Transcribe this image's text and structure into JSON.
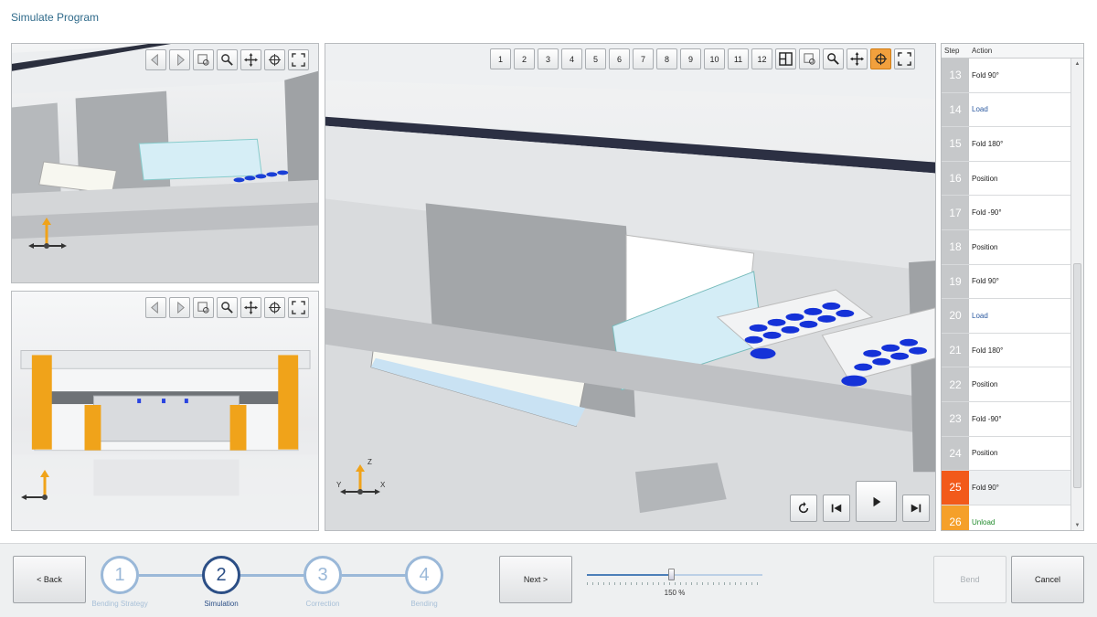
{
  "title": "Simulate Program",
  "viewport_toolbar": {
    "icons": [
      "arrow-left-icon",
      "arrow-right-icon",
      "zoom-window-icon",
      "zoom-icon",
      "pan-icon",
      "rotate-icon",
      "fit-icon"
    ]
  },
  "main_toolbar": {
    "view_buttons": [
      "1",
      "2",
      "3",
      "4",
      "5",
      "6",
      "7",
      "8",
      "9",
      "10",
      "11",
      "12"
    ],
    "icons": [
      "layout-icon",
      "zoom-window-icon",
      "zoom-icon",
      "pan-icon",
      "rotate-icon",
      "fit-icon"
    ],
    "active_icon": "rotate-icon"
  },
  "axis_labels": {
    "z": "Z",
    "y": "Y",
    "x": "X"
  },
  "playback": [
    "reset-icon",
    "step-back-icon",
    "play-icon",
    "step-forward-icon"
  ],
  "steps": {
    "header_step": "Step",
    "header_action": "Action",
    "rows": [
      {
        "n": "13",
        "action": "Fold 90°",
        "kind": "fold"
      },
      {
        "n": "14",
        "action": "Load",
        "kind": "load"
      },
      {
        "n": "15",
        "action": "Fold 180°",
        "kind": "fold"
      },
      {
        "n": "16",
        "action": "Position",
        "kind": "position"
      },
      {
        "n": "17",
        "action": "Fold -90°",
        "kind": "fold"
      },
      {
        "n": "18",
        "action": "Position",
        "kind": "position"
      },
      {
        "n": "19",
        "action": "Fold 90°",
        "kind": "fold"
      },
      {
        "n": "20",
        "action": "Load",
        "kind": "load"
      },
      {
        "n": "21",
        "action": "Fold 180°",
        "kind": "fold"
      },
      {
        "n": "22",
        "action": "Position",
        "kind": "position"
      },
      {
        "n": "23",
        "action": "Fold -90°",
        "kind": "fold"
      },
      {
        "n": "24",
        "action": "Position",
        "kind": "position"
      },
      {
        "n": "25",
        "action": "Fold 90°",
        "kind": "current"
      },
      {
        "n": "26",
        "action": "Unload",
        "kind": "unload"
      }
    ]
  },
  "footer": {
    "back": "< Back",
    "next": "Next >",
    "bend": "Bend",
    "cancel": "Cancel",
    "wizard": [
      {
        "n": "1",
        "label": "Bending Strategy"
      },
      {
        "n": "2",
        "label": "Simulation"
      },
      {
        "n": "3",
        "label": "Correction"
      },
      {
        "n": "4",
        "label": "Bending"
      }
    ],
    "active_step": 1,
    "speed_label": "150 %",
    "speed_fraction": 0.48
  }
}
